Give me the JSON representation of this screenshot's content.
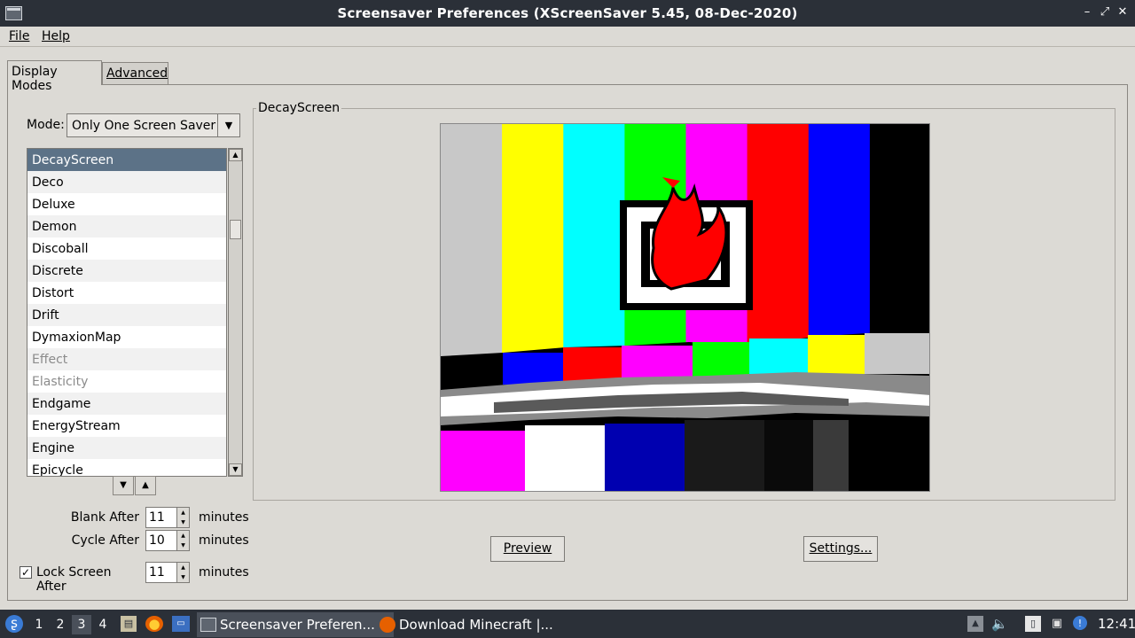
{
  "window": {
    "title": "Screensaver Preferences  (XScreenSaver 5.45, 08-Dec-2020)"
  },
  "menu": {
    "file": "File",
    "help": "Help"
  },
  "tabs": [
    {
      "label": "Display Modes",
      "active": true
    },
    {
      "label": "Advanced",
      "active": false
    }
  ],
  "mode": {
    "label": "Mode:",
    "value": "Only One Screen Saver"
  },
  "savers": [
    {
      "name": "DecayScreen",
      "selected": true
    },
    {
      "name": "Deco"
    },
    {
      "name": "Deluxe"
    },
    {
      "name": "Demon"
    },
    {
      "name": "Discoball"
    },
    {
      "name": "Discrete"
    },
    {
      "name": "Distort"
    },
    {
      "name": "Drift"
    },
    {
      "name": "DymaxionMap"
    },
    {
      "name": "Effect",
      "disabled": true
    },
    {
      "name": "Elasticity",
      "disabled": true
    },
    {
      "name": "Endgame"
    },
    {
      "name": "EnergyStream"
    },
    {
      "name": "Engine"
    },
    {
      "name": "Epicycle"
    }
  ],
  "timing": {
    "blank_label": "Blank After",
    "blank_value": "11",
    "cycle_label": "Cycle After",
    "cycle_value": "10",
    "lock_label": "Lock Screen After",
    "lock_value": "11",
    "lock_checked": true,
    "unit": "minutes"
  },
  "preview_frame": {
    "title": "DecayScreen"
  },
  "buttons": {
    "preview": "Preview",
    "settings": "Settings..."
  },
  "taskbar": {
    "workspaces": [
      "1",
      "2",
      "3",
      "4"
    ],
    "active_workspace": "3",
    "tasks": [
      {
        "label": "Screensaver Preferen...",
        "icon": "window-icon",
        "active": true
      },
      {
        "label": "Download Minecraft |...",
        "icon": "firefox-icon",
        "active": false
      }
    ],
    "clock": "12:41"
  },
  "colors": {
    "accent": "#5c7287",
    "titlebar": "#2b3038",
    "window_bg": "#dcdad5",
    "bars": [
      "#c8c8c8",
      "#ffff00",
      "#00ffff",
      "#00ff00",
      "#ff00ff",
      "#ff0000",
      "#0000ff",
      "#000000"
    ]
  }
}
